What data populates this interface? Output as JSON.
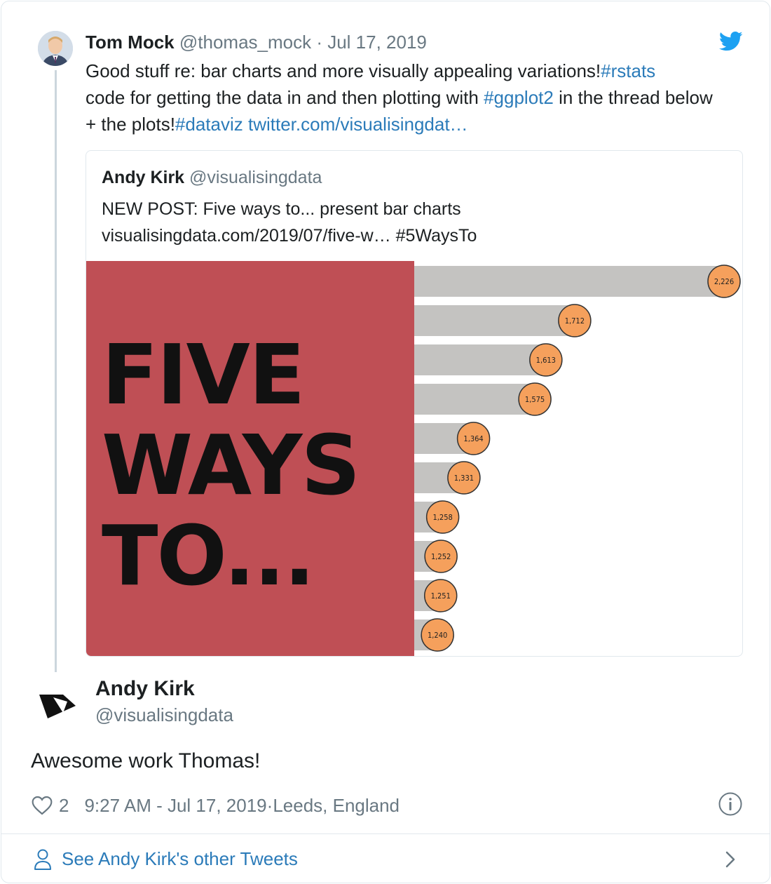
{
  "tweet": {
    "author_name": "Tom Mock",
    "author_handle": "@thomas_mock",
    "separator": " · ",
    "date": "Jul 17, 2019",
    "text_1": "Good stuff re: bar charts and more visually appealing variations!",
    "hashtag_1": "#rstats",
    "text_2": "code for getting the data in and then plotting with ",
    "hashtag_2": "#ggplot2",
    "text_3": " in the thread below + the plots!",
    "hashtag_3": "#dataviz",
    "link": "twitter.com/visualisingdat…"
  },
  "quoted": {
    "author_name": "Andy Kirk",
    "author_handle": "@visualisingdata",
    "line_1": "NEW POST: Five ways to... present bar charts",
    "line_2": "visualisingdata.com/2019/07/five-w… #5WaysTo",
    "image_title_lines": [
      "FIVE",
      "WAYS",
      "TO..."
    ],
    "image_colors": {
      "panel": "#bf4f55",
      "bar": "#c4c3c1",
      "bubble": "#f5a05c",
      "bubble_stroke": "#333333"
    }
  },
  "chart_data": {
    "type": "bar",
    "orientation": "horizontal",
    "categories": [],
    "values": [
      2226,
      1712,
      1613,
      1575,
      1364,
      1331,
      1258,
      1252,
      1251,
      1240
    ],
    "labels": [
      "2,226",
      "1,712",
      "1,613",
      "1,575",
      "1,364",
      "1,331",
      "1,258",
      "1,252",
      "1,251",
      "1,240"
    ],
    "title": "",
    "xlabel": "",
    "ylabel": ""
  },
  "reply": {
    "author_name": "Andy Kirk",
    "author_handle": "@visualisingdata",
    "text": "Awesome work Thomas!",
    "likes": "2",
    "timestamp": "9:27 AM - Jul 17, 2019",
    "location_sep": " · ",
    "location": "Leeds, England"
  },
  "footer": {
    "see_more": "See Andy Kirk's other Tweets"
  },
  "icons": {
    "brand": "twitter-bird-icon",
    "like": "heart-icon",
    "info": "info-icon",
    "profile": "person-icon",
    "more": "chevron-right-icon"
  },
  "colors": {
    "link": "#2b7bb9",
    "muted": "#697882",
    "border": "#e1e8ed",
    "twitter_blue": "#1da1f2"
  }
}
